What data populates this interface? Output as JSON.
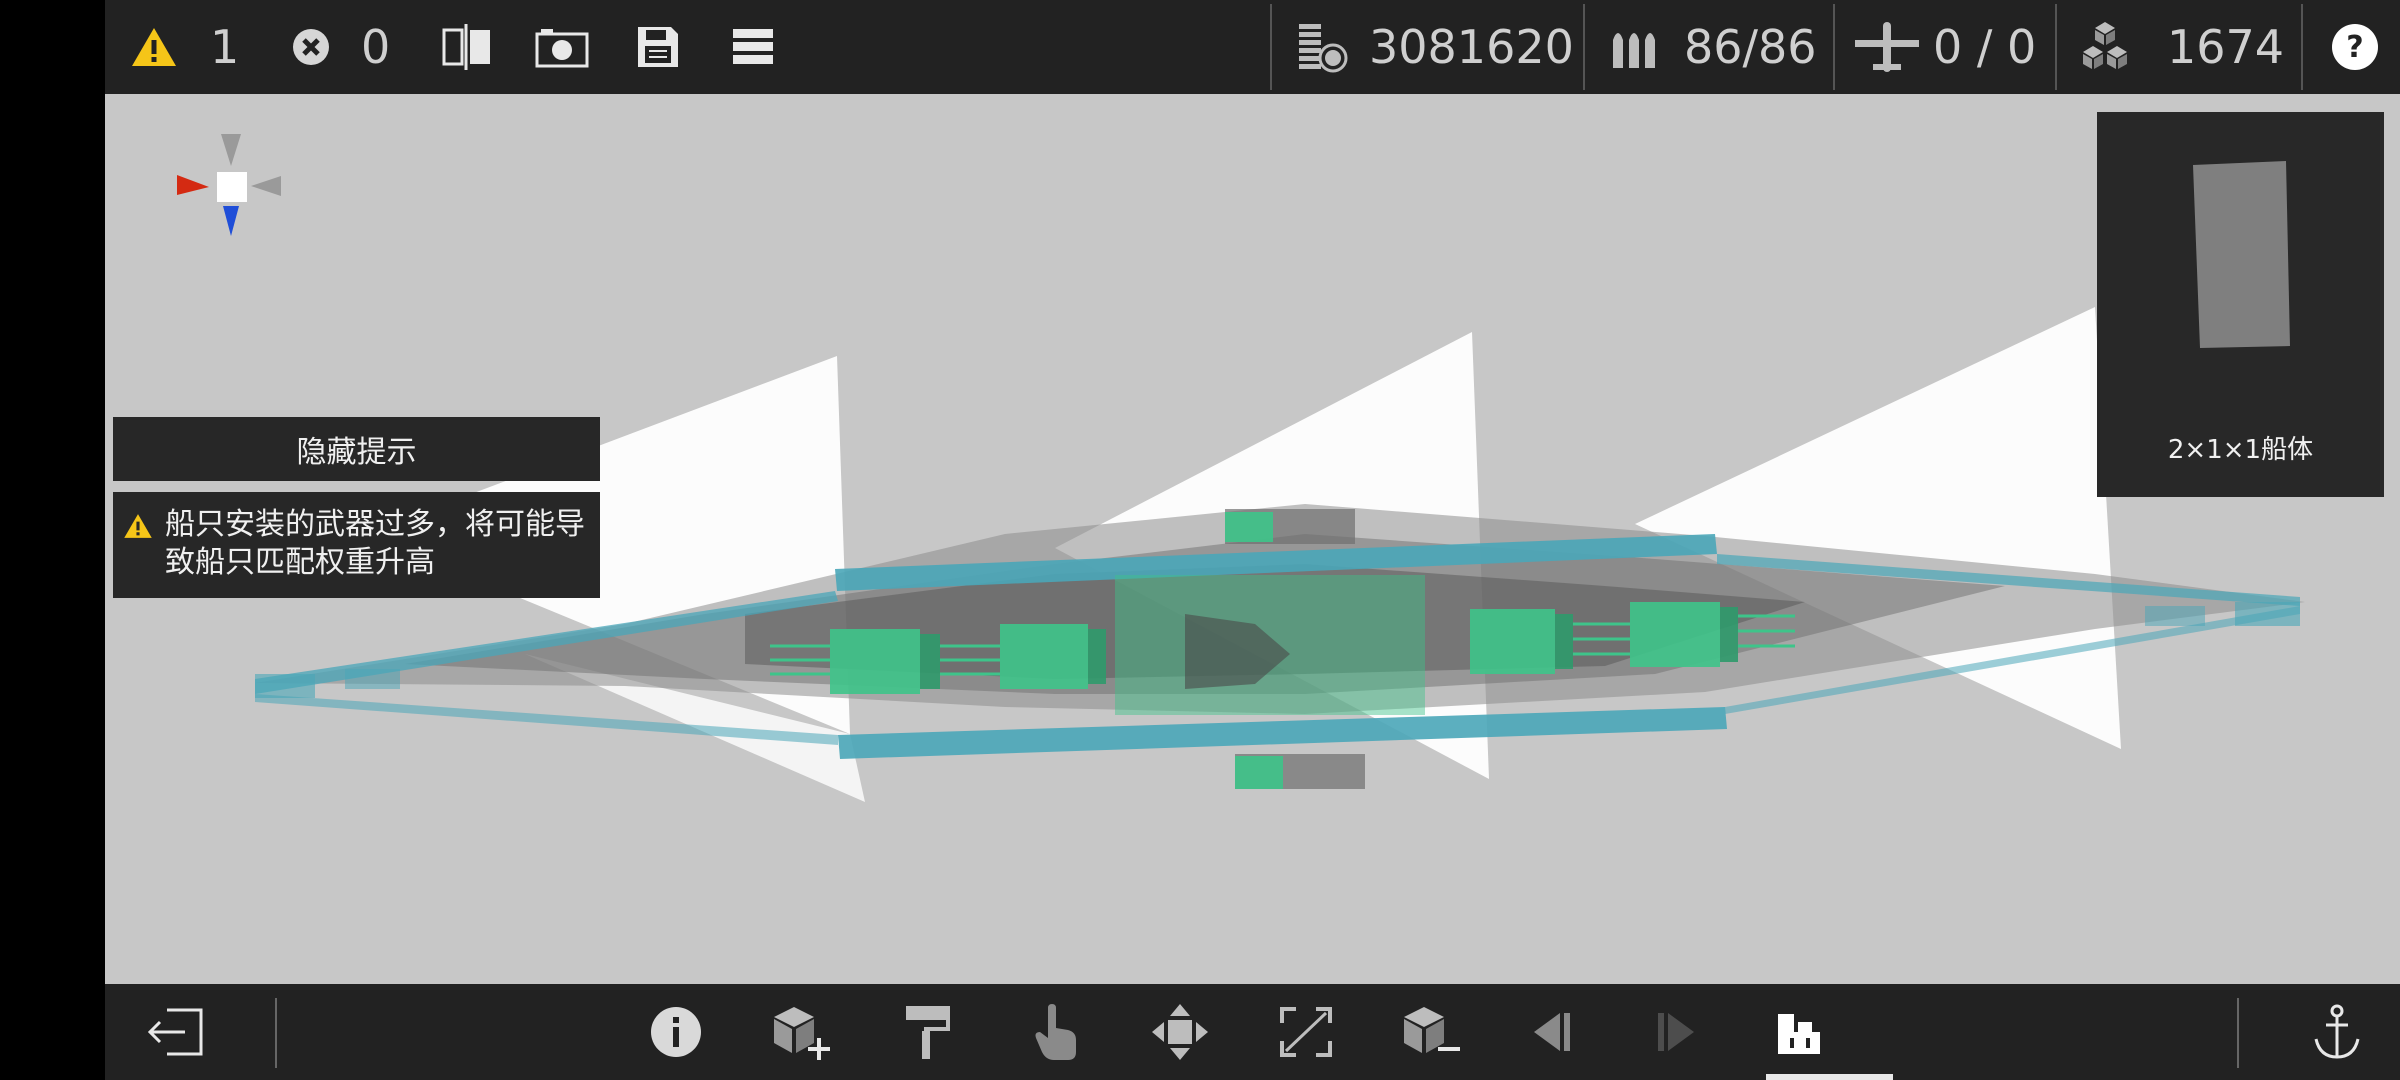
{
  "topbar": {
    "warning_count": "1",
    "error_count": "0",
    "cost_value": "3081620",
    "ammo_value": "86/86",
    "aircraft_value": "0 / 0",
    "parts_value": "1674"
  },
  "hint": {
    "hide_label": "隐藏提示",
    "warning_text": "船只安装的武器过多，将可能导致船只匹配权重升高"
  },
  "preview": {
    "label": "2×1×1船体"
  },
  "colors": {
    "warning": "#f5c518",
    "bar_bg": "#222222",
    "viewport_bg": "#c7c7c7",
    "hull_teal": "#4aa6b8",
    "turret_green": "#3ec48a"
  },
  "icons": {
    "top": [
      "warning-icon",
      "error-icon",
      "mirror-icon",
      "camera-icon",
      "save-icon",
      "menu-icon",
      "cost-icon",
      "ammo-icon",
      "aircraft-icon",
      "parts-icon",
      "help-icon"
    ],
    "bottom": [
      "exit-icon",
      "info-icon",
      "add-block-icon",
      "paint-icon",
      "select-icon",
      "move-icon",
      "resize-icon",
      "remove-block-icon",
      "undo-icon",
      "redo-icon",
      "layer-icon",
      "anchor-icon"
    ]
  }
}
